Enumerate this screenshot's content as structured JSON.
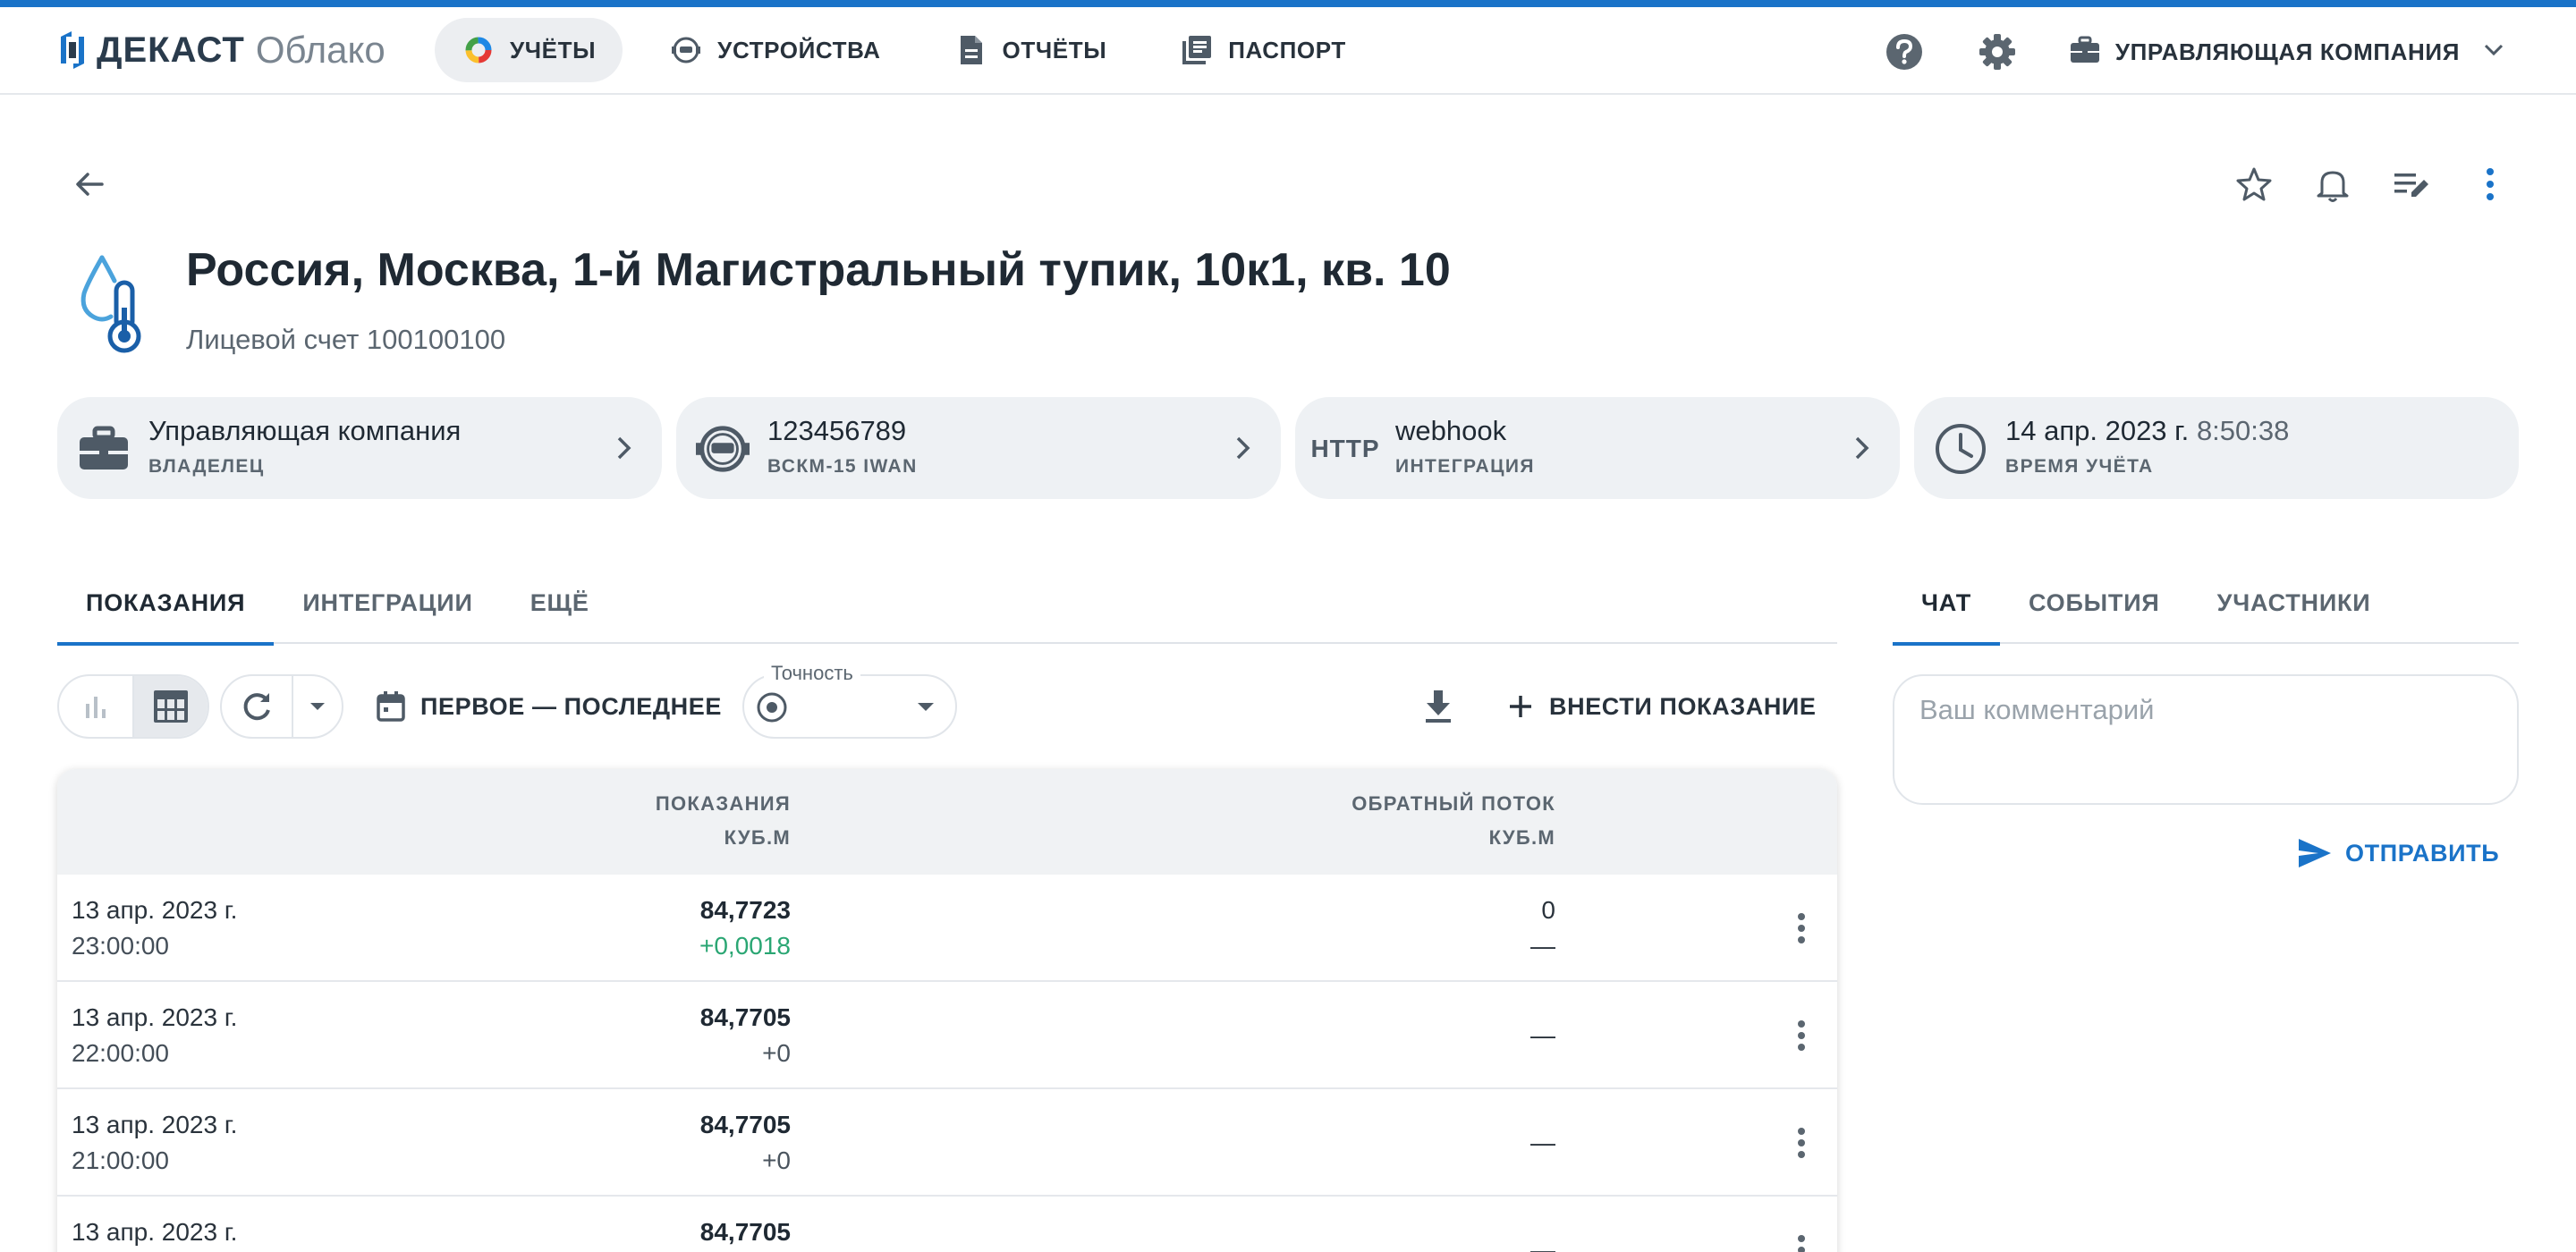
{
  "app": {
    "brand": "ДЕКАСТ",
    "brand_sub": "Облако",
    "accent": "#1a73c8"
  },
  "nav": {
    "items": [
      {
        "label": "УЧЁТЫ",
        "icon": "accounts-pie-icon",
        "active": true
      },
      {
        "label": "УСТРОЙСТВА",
        "icon": "device-meter-icon",
        "active": false
      },
      {
        "label": "ОТЧЁТЫ",
        "icon": "report-document-icon",
        "active": false
      },
      {
        "label": "ПАСПОРТ",
        "icon": "passport-library-icon",
        "active": false
      }
    ],
    "company_label": "УПРАВЛЯЮЩАЯ КОМПАНИЯ"
  },
  "page": {
    "title": "Россия, Москва, 1-й Магистральный тупик, 10к1, кв. 10",
    "subtitle": "Лицевой счет 100100100"
  },
  "cards": [
    {
      "main": "Управляющая компания",
      "label": "ВЛАДЕЛЕЦ",
      "icon": "briefcase-icon"
    },
    {
      "main": "123456789",
      "label": "ВСКМ-15 IWAN",
      "icon": "meter-device-icon"
    },
    {
      "main": "webhook",
      "label": "ИНТЕГРАЦИЯ",
      "icon": "http-icon",
      "icon_text": "HTTP"
    },
    {
      "main_date": "14 апр. 2023 г.",
      "main_time": "8:50:38",
      "label": "ВРЕМЯ УЧЁТА",
      "icon": "clock-icon"
    }
  ],
  "tabs": {
    "left": [
      "ПОКАЗАНИЯ",
      "ИНТЕГРАЦИИ",
      "ЕЩЁ"
    ],
    "right": [
      "ЧАТ",
      "СОБЫТИЯ",
      "УЧАСТНИКИ"
    ]
  },
  "toolbar": {
    "range_label": "ПЕРВОЕ — ПОСЛЕДНЕЕ",
    "precision_label": "Точность",
    "add_label": "ВНЕСТИ ПОКАЗАНИЕ"
  },
  "table": {
    "col_readings": "ПОКАЗАНИЯ",
    "col_readings_unit": "КУБ.М",
    "col_backflow": "ОБРАТНЫЙ ПОТОК",
    "col_backflow_unit": "КУБ.М",
    "rows": [
      {
        "date": "13 апр. 2023 г.",
        "time": "23:00:00",
        "value": "84,7723",
        "delta": "+0,0018",
        "back": "0",
        "back_sub": "—"
      },
      {
        "date": "13 апр. 2023 г.",
        "time": "22:00:00",
        "value": "84,7705",
        "delta": "+0",
        "back": "—",
        "back_sub": ""
      },
      {
        "date": "13 апр. 2023 г.",
        "time": "21:00:00",
        "value": "84,7705",
        "delta": "+0",
        "back": "—",
        "back_sub": ""
      },
      {
        "date": "13 апр. 2023 г.",
        "time": "",
        "value": "84,7705",
        "delta": "",
        "back": "—",
        "back_sub": ""
      }
    ]
  },
  "chat": {
    "placeholder": "Ваш комментарий",
    "send_label": "ОТПРАВИТЬ"
  }
}
